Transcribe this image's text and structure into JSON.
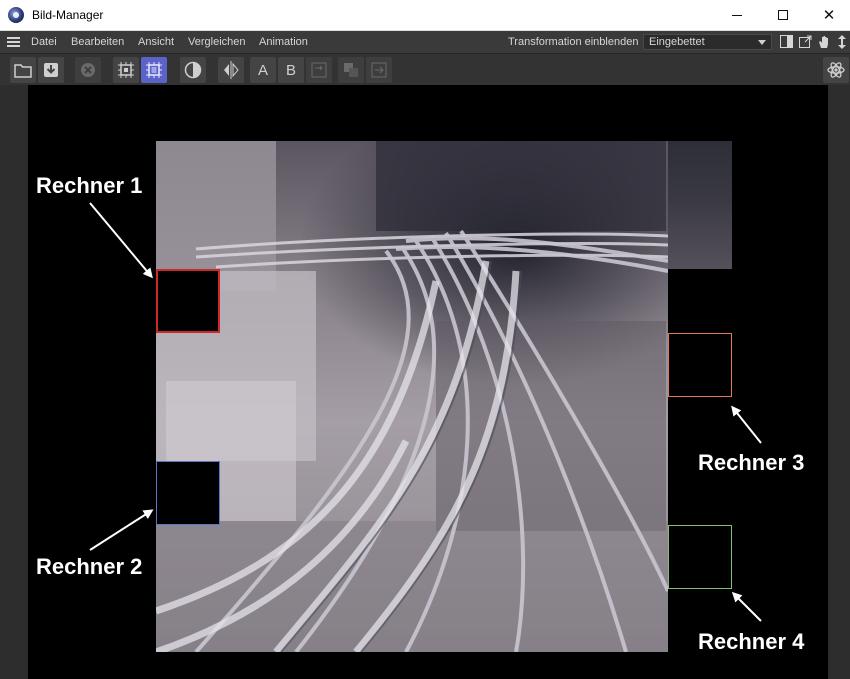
{
  "window": {
    "title": "Bild-Manager",
    "icon": "cinema4d-app-icon"
  },
  "menubar": {
    "items": [
      "Datei",
      "Bearbeiten",
      "Ansicht",
      "Vergleichen",
      "Animation"
    ],
    "transform_label": "Transformation einblenden",
    "transform_select": "Eingebettet"
  },
  "toolbar": {
    "buttons": [
      {
        "name": "open-folder-icon",
        "state": "enabled"
      },
      {
        "name": "save-download-icon",
        "state": "enabled"
      },
      {
        "name": "stop-icon",
        "state": "disabled"
      },
      {
        "name": "render-region-icon",
        "state": "enabled"
      },
      {
        "name": "render-active-icon",
        "state": "active"
      },
      {
        "name": "contrast-icon",
        "state": "enabled"
      },
      {
        "name": "compare-ab-icon",
        "state": "enabled"
      },
      {
        "name": "slot-a",
        "label": "A",
        "state": "enabled"
      },
      {
        "name": "slot-b",
        "label": "B",
        "state": "enabled"
      },
      {
        "name": "swap-icon",
        "state": "disabled"
      },
      {
        "name": "layers-icon",
        "state": "disabled"
      },
      {
        "name": "export-icon",
        "state": "disabled"
      }
    ]
  },
  "viewport": {
    "labels": {
      "rechner1": "Rechner 1",
      "rechner2": "Rechner 2",
      "rechner3": "Rechner 3",
      "rechner4": "Rechner 4"
    },
    "tile_colors": {
      "rechner1": "#cc2a2a",
      "rechner2": "#5a78c8",
      "rechner3": "#e07a55",
      "rechner4": "#86c070"
    }
  },
  "colors": {
    "accent_active": "#5b63c8",
    "menubar_bg": "#3a3a3a",
    "viewport_bg": "#000000"
  }
}
